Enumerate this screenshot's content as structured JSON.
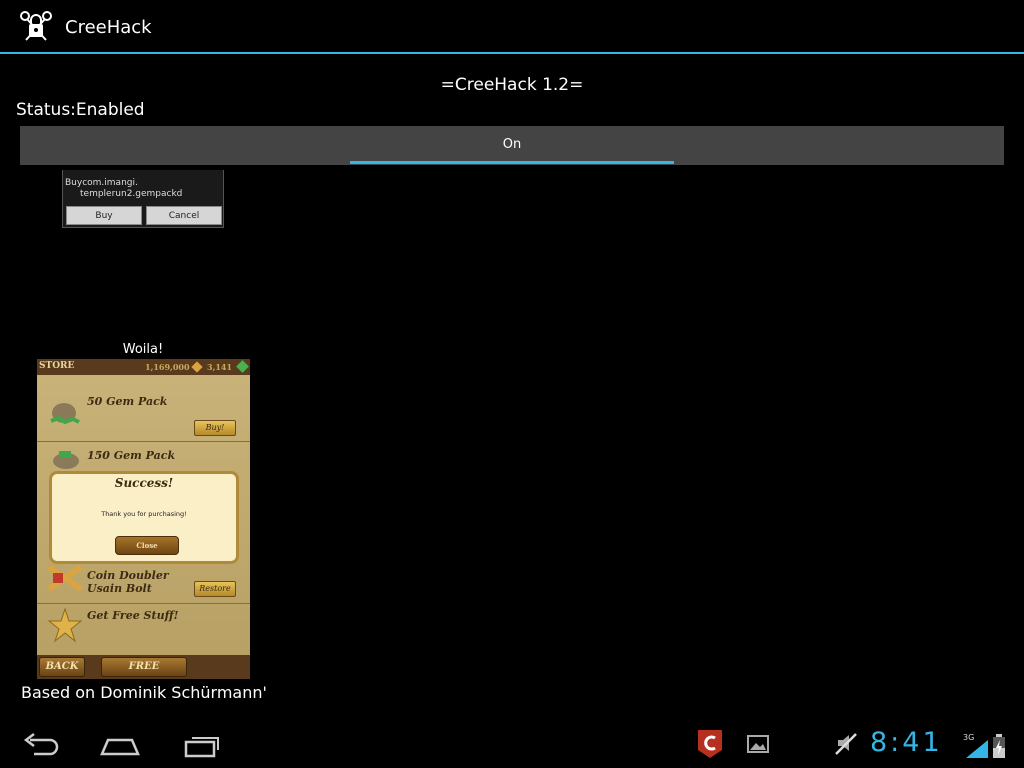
{
  "app": {
    "title": "CreeHack",
    "icon": "lock-key-icon"
  },
  "header": {
    "title": "=CreeHack 1.2=",
    "status": "Status:Enabled"
  },
  "toggle": {
    "label": "On",
    "accent": "#33b5e5"
  },
  "dialog": {
    "line1": "Buycom.imangi.",
    "line2": "templerun2.gempackd",
    "buy_label": "Buy",
    "cancel_label": "Cancel"
  },
  "woila_caption": "Woila!",
  "store": {
    "header": "STORE",
    "coins": "1,169,000",
    "gems": "3,141",
    "items": [
      {
        "name": "50 Gem Pack",
        "button": "Buy!"
      },
      {
        "name": "150 Gem Pack"
      },
      {
        "name": "Coin Doubler Usain Bolt",
        "button": "Restore"
      },
      {
        "name": "Get Free Stuff!"
      }
    ],
    "popup": {
      "title": "Success!",
      "message": "Thank you for purchasing!",
      "close_label": "Close"
    },
    "back_label": "BACK",
    "free_label": "FREE"
  },
  "credit": "Based on Dominik Schürmann'",
  "system_bar": {
    "nav": [
      "back-icon",
      "home-icon",
      "recent-apps-icon"
    ],
    "notifications": [
      "creehack-notification-icon",
      "image-notification-icon"
    ],
    "muted": true,
    "clock": "8:41",
    "network": "3G",
    "battery": "charging"
  }
}
